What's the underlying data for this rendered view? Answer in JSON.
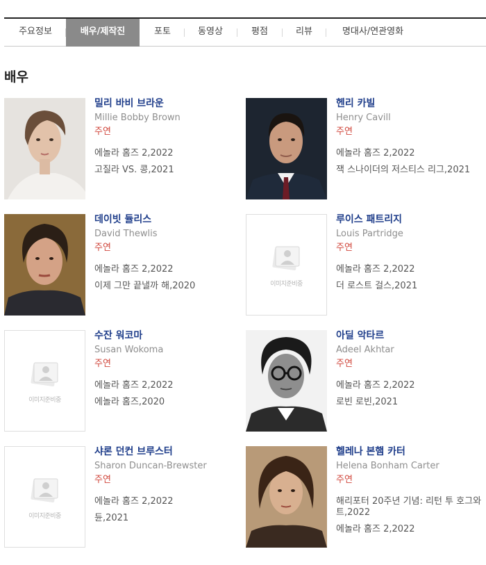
{
  "tabs": [
    {
      "label": "주요정보",
      "active": false
    },
    {
      "label": "배우/제작진",
      "active": true
    },
    {
      "label": "포토",
      "active": false
    },
    {
      "label": "동영상",
      "active": false
    },
    {
      "label": "평점",
      "active": false
    },
    {
      "label": "리뷰",
      "active": false
    },
    {
      "label": "명대사/연관영화",
      "active": false
    }
  ],
  "section": {
    "title": "배우"
  },
  "placeholder_text": "이미지준비중",
  "cast": [
    {
      "korean_name": "밀리 바비 브라운",
      "english_name": "Millie Bobby Brown",
      "role": "주연",
      "works": [
        "에놀라 홈즈 2,2022",
        "고질라 VS. 콩,2021"
      ],
      "has_photo": true
    },
    {
      "korean_name": "헨리 카빌",
      "english_name": "Henry Cavill",
      "role": "주연",
      "works": [
        "에놀라 홈즈 2,2022",
        "잭 스나이더의 저스티스 리그,2021"
      ],
      "has_photo": true
    },
    {
      "korean_name": "데이빗 듈리스",
      "english_name": "David Thewlis",
      "role": "주연",
      "works": [
        "에놀라 홈즈 2,2022",
        "이제 그만 끝낼까 해,2020"
      ],
      "has_photo": true
    },
    {
      "korean_name": "루이스 패트리지",
      "english_name": "Louis Partridge",
      "role": "주연",
      "works": [
        "에놀라 홈즈 2,2022",
        "더 로스트 걸스,2021"
      ],
      "has_photo": false
    },
    {
      "korean_name": "수잔 워코마",
      "english_name": "Susan Wokoma",
      "role": "주연",
      "works": [
        "에놀라 홈즈 2,2022",
        "에놀라 홈즈,2020"
      ],
      "has_photo": false
    },
    {
      "korean_name": "아딜 악타르",
      "english_name": "Adeel Akhtar",
      "role": "주연",
      "works": [
        "에놀라 홈즈 2,2022",
        "로빈 로빈,2021"
      ],
      "has_photo": true
    },
    {
      "korean_name": "샤론 던컨 브루스터",
      "english_name": "Sharon Duncan-Brewster",
      "role": "주연",
      "works": [
        "에놀라 홈즈 2,2022",
        "듄,2021"
      ],
      "has_photo": false
    },
    {
      "korean_name": "헬레나 본햄 카터",
      "english_name": "Helena Bonham Carter",
      "role": "주연",
      "works": [
        "해리포터 20주년 기념: 리턴 투 호그와트,2022",
        "에놀라 홈즈 2,2022"
      ],
      "has_photo": true
    }
  ],
  "colors": {
    "name_link": "#1e3d8a",
    "role": "#d0463b",
    "active_tab": "#8a8a8a"
  }
}
